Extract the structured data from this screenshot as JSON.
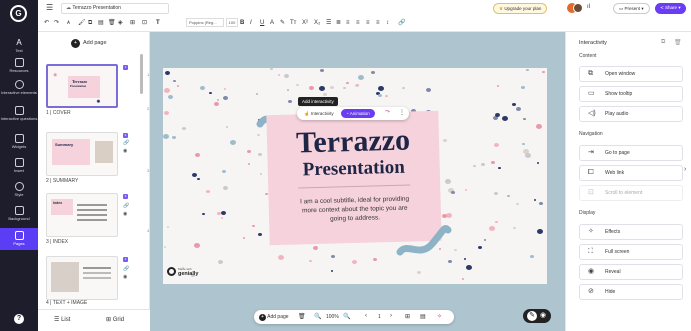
{
  "rail": {
    "items": [
      {
        "label": "Text",
        "icon": "text-icon"
      },
      {
        "label": "Resources",
        "icon": "resources-icon"
      },
      {
        "label": "Interactive elements",
        "icon": "interactive-elements-icon"
      },
      {
        "label": "Interactive questions",
        "icon": "interactive-questions-icon"
      },
      {
        "label": "Widgets",
        "icon": "widgets-icon"
      },
      {
        "label": "Insert",
        "icon": "insert-icon"
      },
      {
        "label": "Style",
        "icon": "style-icon"
      },
      {
        "label": "Background",
        "icon": "background-icon"
      },
      {
        "label": "Pages",
        "icon": "pages-icon"
      }
    ],
    "help": "?"
  },
  "topbar": {
    "doc_title": "Terrazzo Presentation",
    "font_name": "Poppins (Reg...",
    "font_size": "100",
    "upgrade": "Upgrade your plan",
    "present": "Present",
    "share": "Share"
  },
  "slides_panel": {
    "add_page": "Add page",
    "pages": [
      {
        "label": "1 | COVER",
        "num": "1"
      },
      {
        "label": "2 | SUMMARY",
        "num": "2"
      },
      {
        "label": "3 | INDEX",
        "num": "3"
      },
      {
        "label": "4 | TEXT + IMAGE",
        "num": "4"
      }
    ],
    "view_list": "List",
    "view_grid": "Grid"
  },
  "slide": {
    "tooltip": "Add interactivity",
    "interactivity": "Interactivity",
    "animation": "Animation",
    "title_line1": "Terrazzo",
    "title_line2": "Presentation",
    "subtitle": "I am a cool subtitle, ideal for providing more context about the topic you are going to address.",
    "logo_text_small": "Made with",
    "logo_text": "genially"
  },
  "bottom_bar": {
    "add_page": "Add page",
    "zoom": "100%",
    "page_num": "1"
  },
  "right_panel": {
    "title": "Interactivity",
    "sections": [
      {
        "name": "Content",
        "items": [
          {
            "label": "Open window",
            "icon": "open-window-icon"
          },
          {
            "label": "Show tooltip",
            "icon": "show-tooltip-icon"
          },
          {
            "label": "Play audio",
            "icon": "play-audio-icon"
          }
        ]
      },
      {
        "name": "Navigation",
        "items": [
          {
            "label": "Go to page",
            "icon": "go-to-page-icon"
          },
          {
            "label": "Web link",
            "icon": "web-link-icon"
          },
          {
            "label": "Scroll to element",
            "icon": "scroll-to-element-icon"
          }
        ]
      },
      {
        "name": "Display",
        "items": [
          {
            "label": "Effects",
            "icon": "effects-icon"
          },
          {
            "label": "Full screen",
            "icon": "full-screen-icon"
          },
          {
            "label": "Reveal",
            "icon": "reveal-icon"
          },
          {
            "label": "Hide",
            "icon": "hide-icon"
          }
        ]
      }
    ]
  },
  "colors": {
    "rail_bg": "#1d1d2b",
    "accent": "#5b3df5",
    "canvas_bg": "#aec5d0",
    "card_pink": "#f6d3dc",
    "title_navy": "#1f2545",
    "swoosh_blue": "#8fb3c6"
  }
}
